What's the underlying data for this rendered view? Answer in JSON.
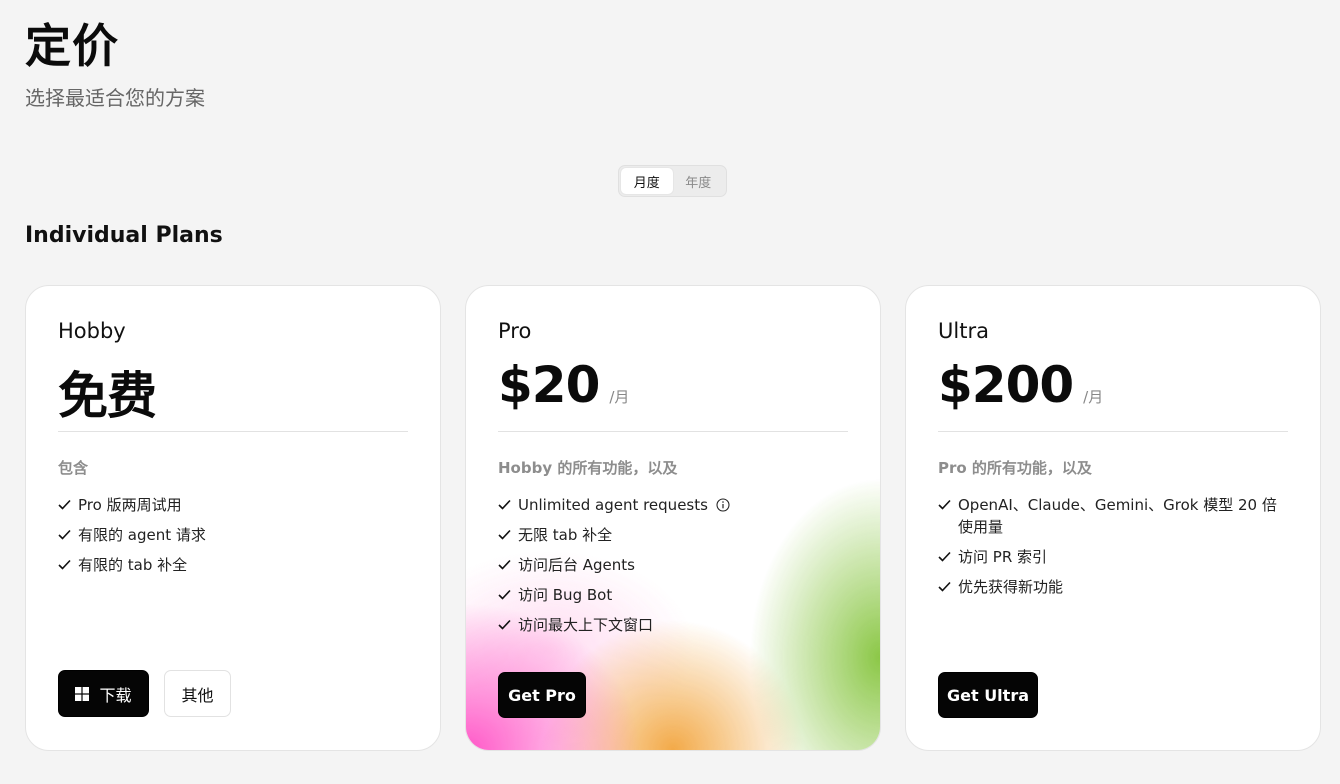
{
  "header": {
    "title": "定价",
    "subtitle": "选择最适合您的方案"
  },
  "billing_toggle": {
    "options": [
      "月度",
      "年度"
    ],
    "selected": "月度"
  },
  "section_title": "Individual Plans",
  "plans": [
    {
      "name": "Hobby",
      "price": "免费",
      "period": "",
      "includes_label": "包含",
      "features": [
        "Pro 版两周试用",
        "有限的 agent 请求",
        "有限的 tab 补全"
      ],
      "buttons": [
        {
          "label": "下载",
          "icon": "windows-icon",
          "style": "dark"
        },
        {
          "label": "其他",
          "style": "light"
        }
      ]
    },
    {
      "name": "Pro",
      "price": "$20",
      "period": "/月",
      "includes_label": "Hobby 的所有功能，以及",
      "features": [
        "Unlimited agent requests",
        "无限 tab 补全",
        "访问后台 Agents",
        "访问 Bug Bot",
        "访问最大上下文窗口"
      ],
      "feature_info_icon": "info-icon",
      "accent_colors": [
        "#ff3cbe",
        "#f0961e",
        "#78be28"
      ],
      "buttons": [
        {
          "label": "Get Pro",
          "style": "dark"
        }
      ]
    },
    {
      "name": "Ultra",
      "price": "$200",
      "period": "/月",
      "includes_label": "Pro 的所有功能，以及",
      "features": [
        "OpenAI、Claude、Gemini、Grok 模型 20 倍使用量",
        "访问 PR 索引",
        "优先获得新功能"
      ],
      "buttons": [
        {
          "label": "Get Ultra",
          "style": "dark"
        }
      ]
    }
  ]
}
